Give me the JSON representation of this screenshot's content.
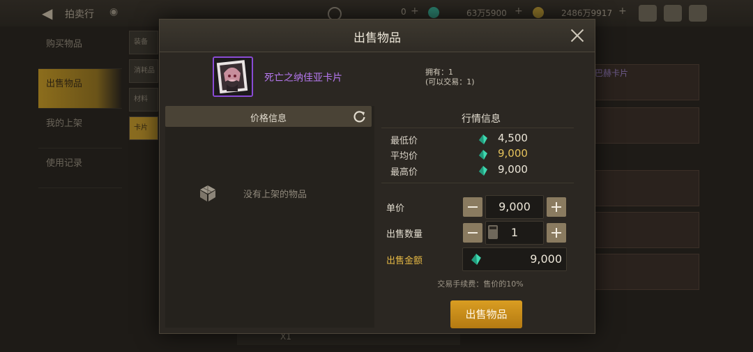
{
  "topbar": {
    "title": "拍卖行",
    "currency1": "0",
    "currency2": "63万5900",
    "currency3": "2486万9917"
  },
  "sidebar": {
    "items": [
      {
        "label": "购买物品"
      },
      {
        "label": "出售物品"
      },
      {
        "label": "我的上架"
      },
      {
        "label": "使用记录"
      }
    ]
  },
  "category_tabs": [
    "装备",
    "消耗品",
    "材料",
    "卡片"
  ],
  "background": {
    "right_card_text": "巴赫卡片",
    "bottom_count": "X1"
  },
  "modal": {
    "title": "出售物品",
    "item": {
      "name": "死亡之纳佳亚卡片",
      "owned": "拥有：1",
      "tradable": "(可以交易：1)"
    },
    "price_info": {
      "title": "价格信息",
      "empty_text": "没有上架的物品"
    },
    "market": {
      "title": "行情信息",
      "rows": [
        {
          "label": "最低价",
          "value": "4,500"
        },
        {
          "label": "平均价",
          "value": "9,000"
        },
        {
          "label": "最高价",
          "value": "9,000"
        }
      ]
    },
    "form": {
      "unit_price_label": "单价",
      "unit_price": "9,000",
      "quantity_label": "出售数量",
      "quantity": "1",
      "total_label": "出售金额",
      "total": "9,000",
      "fee_text": "交易手续费：售价的10%"
    },
    "sell_button": "出售物品"
  },
  "colors": {
    "accent_gold": "#d99d22",
    "item_purple": "#b678f0",
    "gem_teal": "#3fd9b0"
  }
}
